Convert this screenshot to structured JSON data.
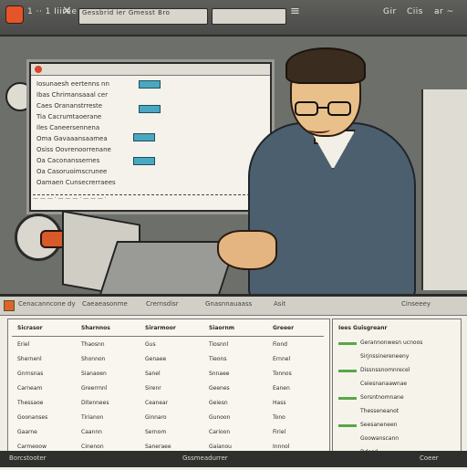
{
  "topbar": {
    "left_label": "1 ·· 1 Iiiree",
    "search_text": "Gessbrid ier Gmesst Bro",
    "right_labels": [
      "Gir",
      "Ciis",
      "ar ~"
    ],
    "icons": [
      "app-logo-icon",
      "close-icon",
      "menu-icon",
      "settings-icon",
      "settings-icon"
    ]
  },
  "monitor": {
    "rows": [
      "Iosunaesh  eertenns nn",
      "Ibas  Chrimansaaal cer",
      "Caes  Orananstrreste",
      "Tia  Cacrumtaoerane",
      "Iles  Caneersennena",
      "Oma  Gavaaansaamea",
      "Osiss  Oovrenoorrenane",
      "Oa  Caconanssernes",
      "Oa  Casoruoimscrunee",
      "Oamaen  Cunsecrerraees"
    ],
    "footer": "— — — · — — — · — — — ·"
  },
  "sheet": {
    "tabs": [
      "Cenacanncone dy",
      "Caeaeasonme",
      "Crernsdisr",
      "Gnasnnauaass",
      "Asit",
      "Cinseeey"
    ],
    "headers": [
      "Sicrasor",
      "Sharnnos",
      "Sirarmoor",
      "Siaornm",
      "Greeer"
    ],
    "rows": [
      [
        "Eriel",
        "Thaosnn",
        "Gus",
        "Tiosnnl",
        "Fiond"
      ],
      [
        "Shernenl",
        "Shonnon",
        "Genaee",
        "Tieons",
        "Ernnel"
      ],
      [
        "Gnrnsnas",
        "Sianaoen",
        "Sanel",
        "Snnaee",
        "Tonnos"
      ],
      [
        "Carneam",
        "Greerrnnl",
        "Sirenr",
        "Geenes",
        "Eanen"
      ],
      [
        "Thessaoe",
        "Ditennees",
        "Ceanear",
        "Geiesn",
        "Hass"
      ],
      [
        "Goonanses",
        "Tirianon",
        "Ginnaro",
        "Gunoon",
        "Tono"
      ],
      [
        "Gaarne",
        "Caannn",
        "Sernom",
        "Carioon",
        "Firiel"
      ],
      [
        "Carmeoow",
        "Cinenon",
        "Saneraee",
        "Gaianou",
        "Innnol"
      ]
    ],
    "side": {
      "header": "Iees  Guisgreanr",
      "items": [
        "Gerannonwesn ucnoos",
        "Sirjnssinereneeny",
        "Dissnssnomnrecel",
        "Ceiesnanaawnae",
        "Sorsntnomnane",
        "Thesseneanot",
        "Seesaneneen",
        "Goowanscann",
        "Ddasd"
      ]
    }
  },
  "statusbar": {
    "left": "Borcstooter",
    "middle": "Gssmeadurrer",
    "right": "Coeer"
  },
  "colors": {
    "accent": "#e4552a",
    "chip": "#4aa7c2",
    "green": "#5aa54a"
  }
}
